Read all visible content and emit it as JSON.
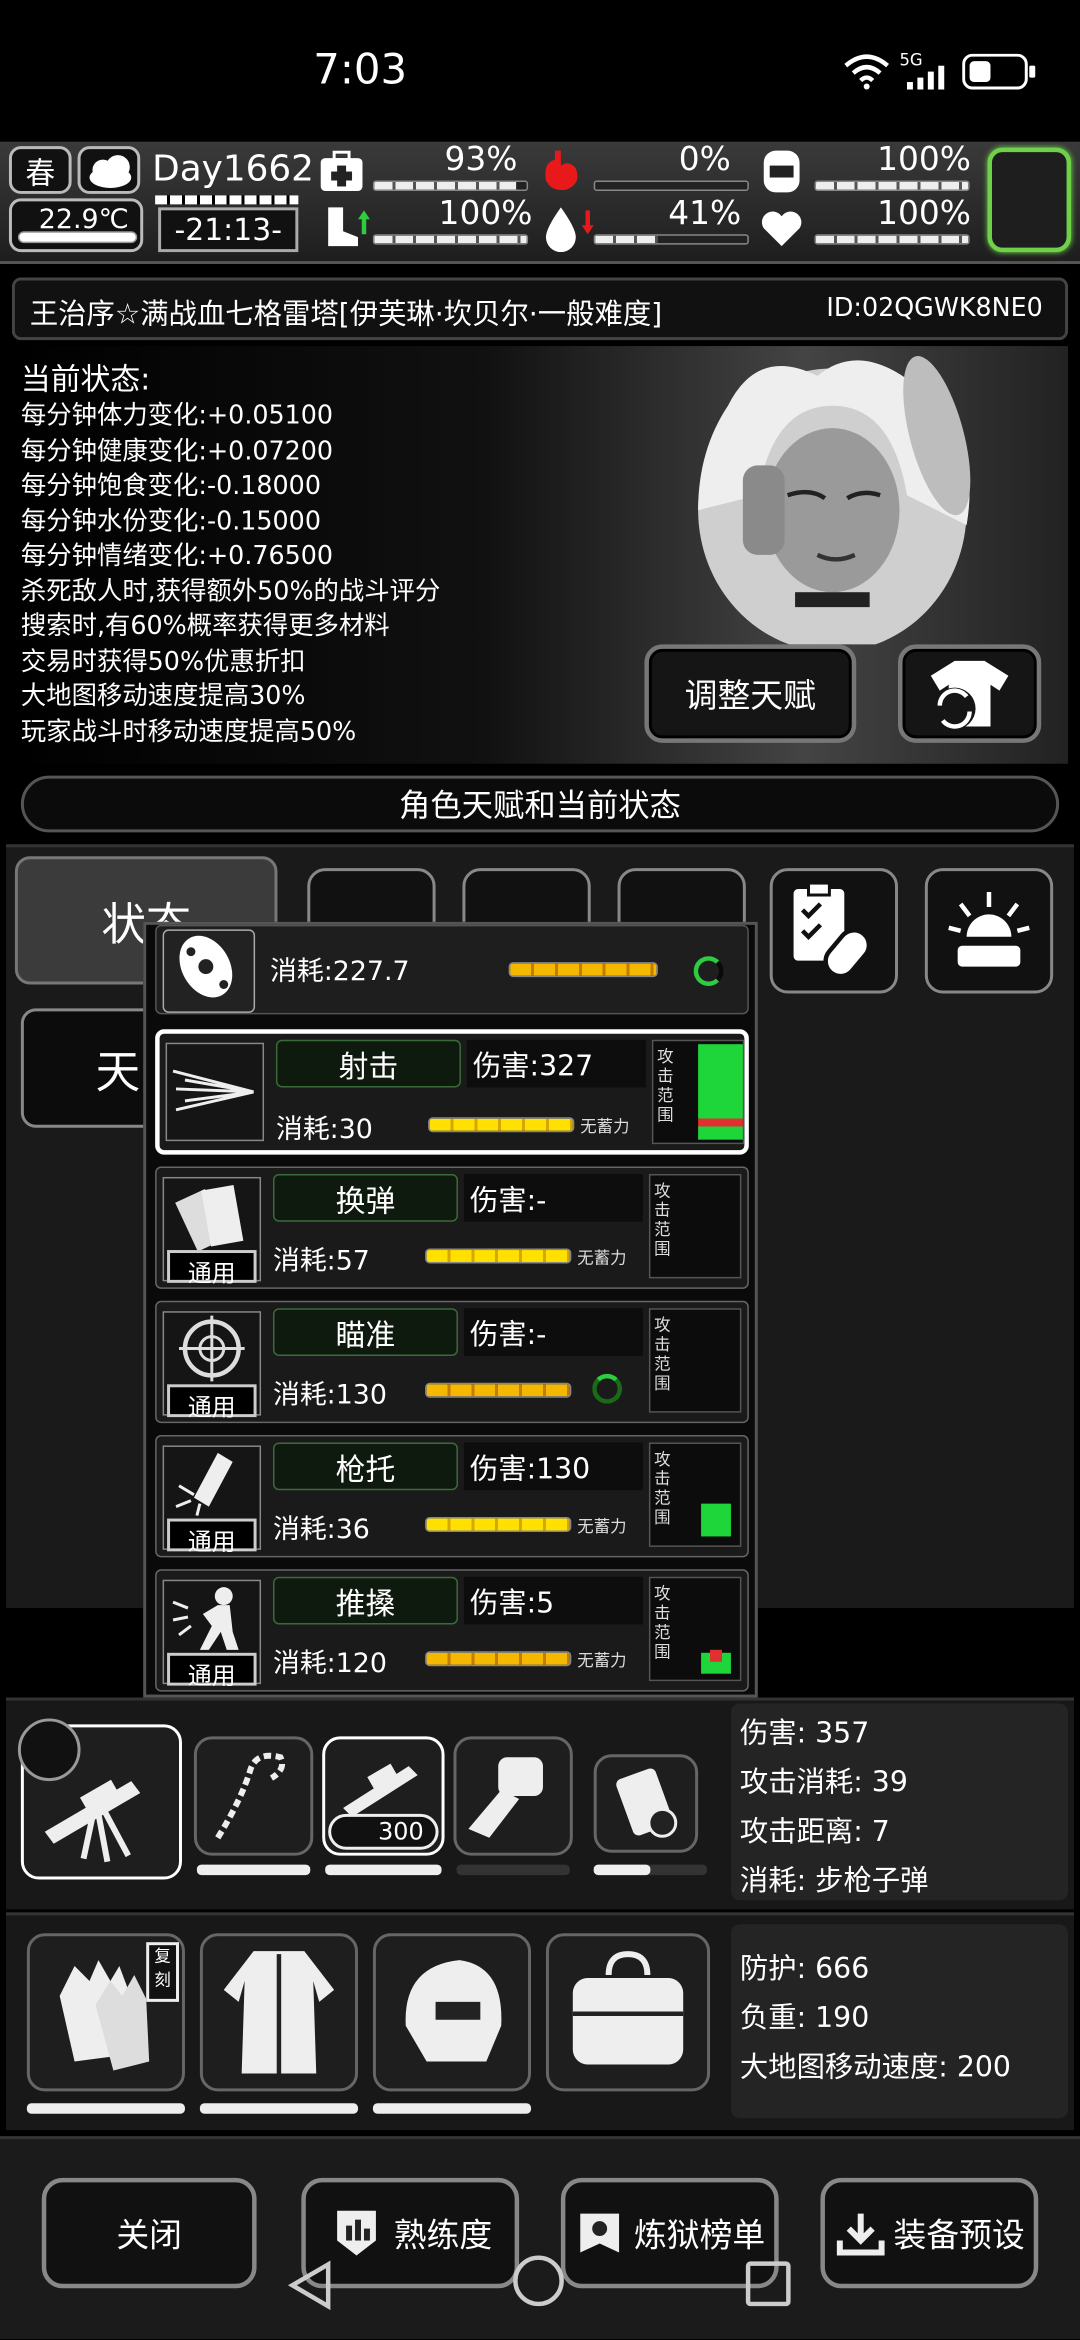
{
  "status_bar": {
    "time": "7:03",
    "network": "5G"
  },
  "hud": {
    "season": "春",
    "temperature": "22.9℃",
    "day": "Day1662",
    "clock": "-21:13-",
    "stats": [
      {
        "name": "stamina",
        "value": "93%",
        "fill": 0.93
      },
      {
        "name": "hunger",
        "value": "0%",
        "fill": 0.0
      },
      {
        "name": "armor",
        "value": "100%",
        "fill": 1.0
      },
      {
        "name": "movement",
        "value": "100%",
        "fill": 1.0
      },
      {
        "name": "water",
        "value": "41%",
        "fill": 0.41
      },
      {
        "name": "mood",
        "value": "100%",
        "fill": 1.0
      }
    ]
  },
  "character": {
    "title": "王治序☆满战血七格雷塔[伊芙琳·坎贝尔·一般难度]",
    "id": "ID:02QGWK8NE0"
  },
  "status": {
    "heading": "当前状态:",
    "lines": [
      "每分钟体力变化:+0.05100",
      "每分钟健康变化:+0.07200",
      "每分钟饱食变化:-0.18000",
      "每分钟水份变化:-0.15000",
      "每分钟情绪变化:+0.76500",
      "杀死敌人时,获得额外50%的战斗评分",
      "搜索时,有60%概率获得更多材料",
      "交易时获得50%优惠折扣",
      "大地图移动速度提高30%",
      "玩家战斗时移动速度提高50%"
    ],
    "adjust_talent_button": "调整天赋"
  },
  "section_title": "角色天赋和当前状态",
  "left_tabs": {
    "status": "状态",
    "talent": "天"
  },
  "popup": {
    "move_cost": "消耗:227.7",
    "range_label": [
      "攻",
      "击",
      "范",
      "围"
    ],
    "common_label": "通用",
    "no_charge": "无蓄力",
    "skills": [
      {
        "name": "射击",
        "damage": "伤害:327",
        "cost": "消耗:30",
        "charge": "无蓄力",
        "icon": "shoot-icon",
        "selected": true,
        "common": false
      },
      {
        "name": "换弹",
        "damage": "伤害:-",
        "cost": "消耗:57",
        "charge": "无蓄力",
        "icon": "reload-icon",
        "selected": false,
        "common": true
      },
      {
        "name": "瞄准",
        "damage": "伤害:-",
        "cost": "消耗:130",
        "charge": "",
        "icon": "aim-icon",
        "selected": false,
        "common": true
      },
      {
        "name": "枪托",
        "damage": "伤害:130",
        "cost": "消耗:36",
        "charge": "无蓄力",
        "icon": "buttstock-icon",
        "selected": false,
        "common": true
      },
      {
        "name": "推搡",
        "damage": "伤害:5",
        "cost": "消耗:120",
        "charge": "无蓄力",
        "icon": "shove-icon",
        "selected": false,
        "common": true
      }
    ]
  },
  "weapon": {
    "ammo_count": "300",
    "stats": [
      "伤害: 357",
      "攻击消耗: 39",
      "攻击距离: 7",
      "消耗: 步枪子弹"
    ]
  },
  "armor": {
    "copy_badge": "复刻",
    "stats": [
      "防护: 666",
      "负重: 190",
      "大地图移动速度: 200"
    ]
  },
  "bottom_buttons": {
    "close": "关闭",
    "proficiency": "熟练度",
    "ranking": "炼狱榜单",
    "preset": "装备预设"
  }
}
